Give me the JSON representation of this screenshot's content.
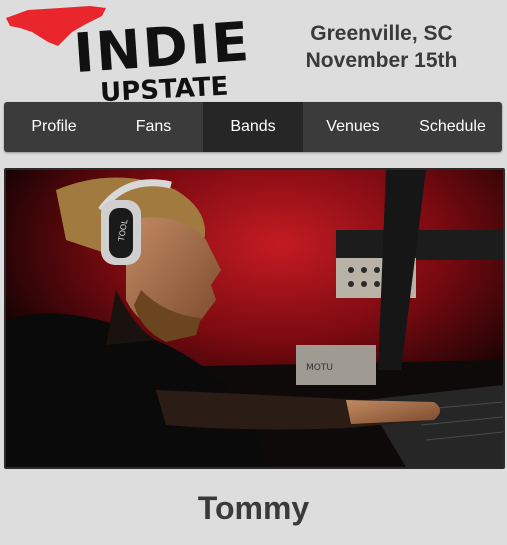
{
  "logo": {
    "line1": "INDIE",
    "line2": "UPSTATE",
    "accent_color": "#e8262b"
  },
  "event": {
    "city": "Greenville, SC",
    "date": "November 15th"
  },
  "nav": {
    "items": [
      {
        "label": "Profile",
        "active": false
      },
      {
        "label": "Fans",
        "active": false
      },
      {
        "label": "Bands",
        "active": true
      },
      {
        "label": "Venues",
        "active": false
      },
      {
        "label": "Schedule",
        "active": false
      }
    ]
  },
  "photo": {
    "equipment_labels": [
      "TOOL",
      "MOTU"
    ]
  },
  "band": {
    "name": "Tommy"
  },
  "colors": {
    "background": "#dddddd",
    "nav_bg": "#3b3b3b",
    "nav_active": "#262626",
    "text": "#3a3a3a"
  }
}
